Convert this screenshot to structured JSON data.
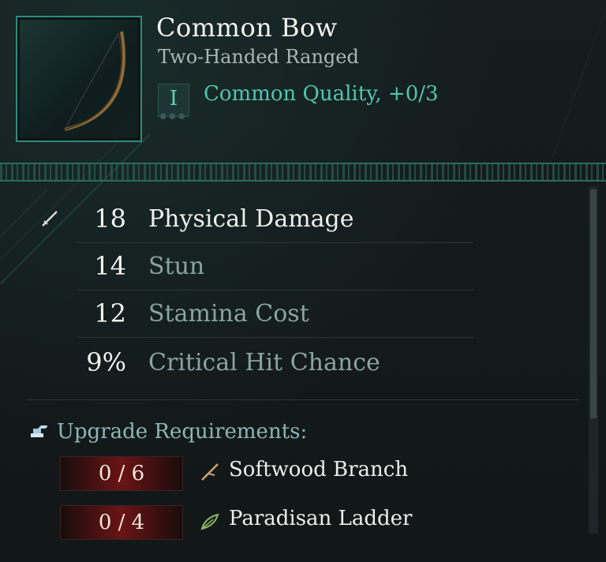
{
  "item": {
    "name": "Common Bow",
    "type": "Two-Handed Ranged",
    "quality_tier": "I",
    "quality_text": "Common Quality, +0/3",
    "thumbnail_icon": "bow-icon"
  },
  "stats": [
    {
      "value": "18",
      "label": "Physical Damage",
      "icon": "sword-icon",
      "primary": true
    },
    {
      "value": "14",
      "label": "Stun",
      "primary": false
    },
    {
      "value": "12",
      "label": "Stamina Cost",
      "primary": false
    },
    {
      "value": "9%",
      "label": "Critical Hit Chance",
      "primary": false
    }
  ],
  "upgrade": {
    "title": "Upgrade Requirements:",
    "icon": "anvil-icon",
    "materials": [
      {
        "count": "0 / 6",
        "name": "Softwood Branch",
        "icon": "branch-icon"
      },
      {
        "count": "0 / 4",
        "name": "Paradisan Ladder",
        "icon": "leaf-icon"
      }
    ]
  },
  "colors": {
    "accent_teal": "#4ec7b0",
    "border_teal": "#2f8c7c",
    "secondary_text": "#8aa3a1",
    "requirement_red": "#6a1414"
  }
}
